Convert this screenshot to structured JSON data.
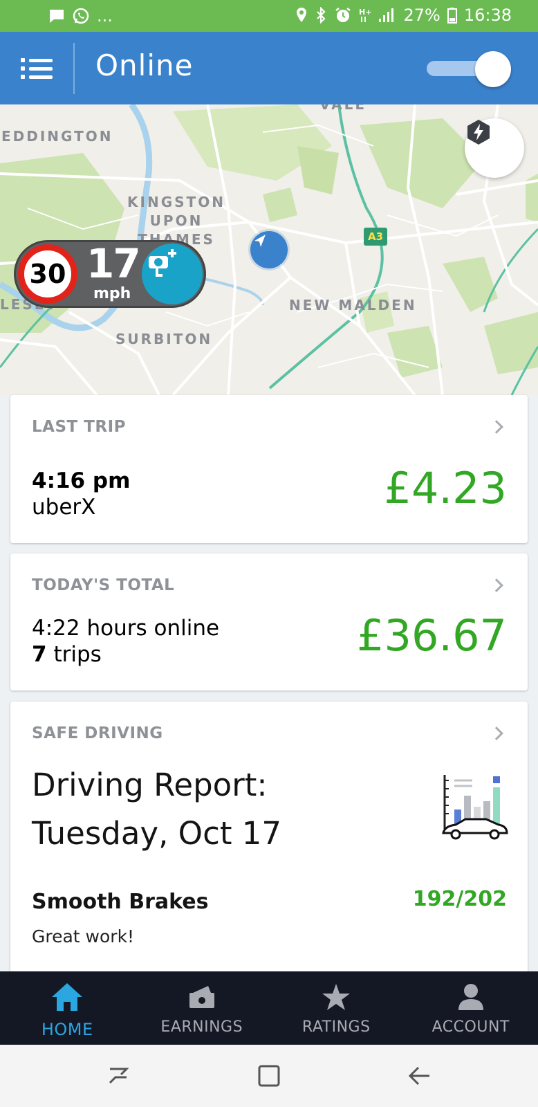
{
  "status_bar": {
    "overflow_dots": "...",
    "battery": "27%",
    "time": "16:38",
    "bg_color": "#6bba52",
    "left_icons": [
      "message-icon",
      "whatsapp-icon"
    ],
    "right_icons": [
      "location-icon",
      "bluetooth-icon",
      "alarm-icon",
      "hplus-icon",
      "signal-icon",
      "battery-icon"
    ]
  },
  "header": {
    "title": "Online",
    "menu_icon": "menu-list-icon",
    "online_toggle": "on",
    "bg_color": "#3a82cc"
  },
  "map": {
    "labels": {
      "teddington": "EDDINGTON",
      "kingston": "KINGSTON\nUPON\nTHAMES",
      "new_malden": "NEW MALDEN",
      "surbiton": "SURBITON",
      "molesey": "LESEY",
      "vale": "VALE"
    },
    "road_badge": "A3",
    "speed_limit": "30",
    "current_speed": "17",
    "speed_unit": "mph",
    "surge_icon": "lightning-icon",
    "speed_camera_icon": "speed-camera-add-icon",
    "location_icon": "navigation-arrow-icon"
  },
  "last_trip": {
    "label": "LAST TRIP",
    "time": "4:16 pm",
    "product": "uberX",
    "amount": "£4.23"
  },
  "todays_total": {
    "label": "TODAY'S TOTAL",
    "hours_online": "4:22 hours online",
    "trips_count": "7",
    "trips_word": "trips",
    "amount": "£36.67"
  },
  "safe_driving": {
    "label": "SAFE DRIVING",
    "report_title": "Driving Report: Tuesday, Oct 17",
    "report_icon": "driving-report-chart-icon",
    "metric_name": "Smooth Brakes",
    "metric_score": "192/202",
    "metric_note": "Great work!"
  },
  "bottom_nav": {
    "items": [
      {
        "label": "HOME",
        "icon": "home-icon",
        "active": true
      },
      {
        "label": "EARNINGS",
        "icon": "earnings-icon",
        "active": false
      },
      {
        "label": "RATINGS",
        "icon": "star-icon",
        "active": false
      },
      {
        "label": "ACCOUNT",
        "icon": "person-icon",
        "active": false
      }
    ],
    "active_color": "#2aa6e1"
  },
  "accent_green": "#32a724"
}
